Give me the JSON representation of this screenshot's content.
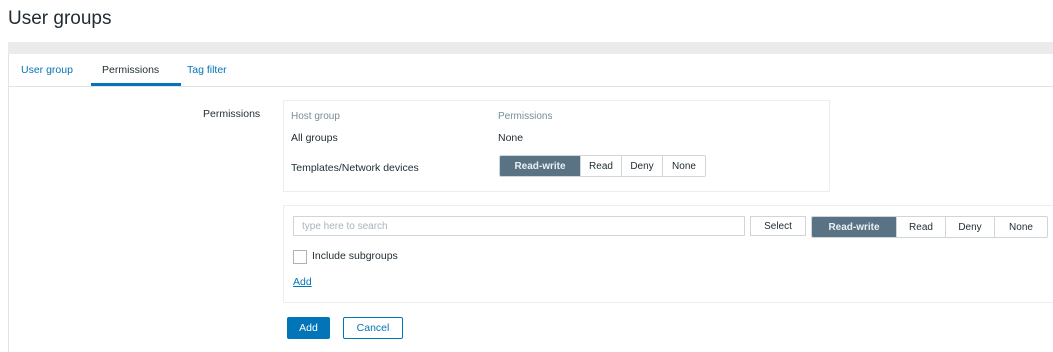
{
  "page": {
    "title": "User groups"
  },
  "tabs": [
    {
      "label": "User group",
      "active": false
    },
    {
      "label": "Permissions",
      "active": true
    },
    {
      "label": "Tag filter",
      "active": false
    }
  ],
  "permissions": {
    "label": "Permissions",
    "headers": {
      "host_group": "Host group",
      "permissions": "Permissions"
    },
    "rows": [
      {
        "group": "All groups",
        "permission": "None"
      },
      {
        "group": "Templates/Network devices",
        "options": [
          "Read-write",
          "Read",
          "Deny",
          "None"
        ],
        "selected": "Read-write"
      }
    ]
  },
  "add_form": {
    "search_placeholder": "type here to search",
    "select_label": "Select",
    "options": [
      "Read-write",
      "Read",
      "Deny",
      "None"
    ],
    "selected": "Read-write",
    "include_subgroups_label": "Include subgroups",
    "include_subgroups_checked": false,
    "add_link_label": "Add"
  },
  "footer": {
    "add_label": "Add",
    "cancel_label": "Cancel"
  },
  "colors": {
    "accent": "#0275b8",
    "selected_segment": "#5a7384"
  },
  "icons": {
    "checkbox": "checkbox-icon"
  }
}
